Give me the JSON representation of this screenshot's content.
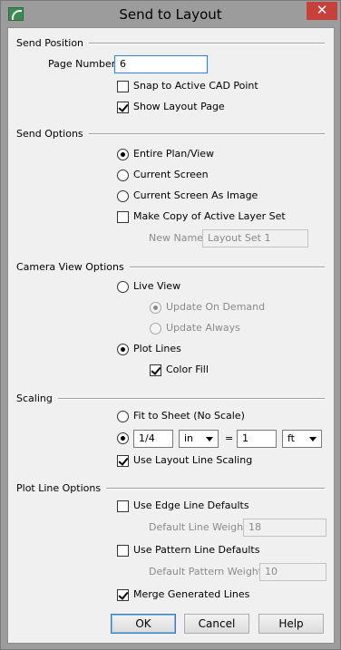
{
  "window": {
    "title": "Send to Layout",
    "close_glyph": "✕"
  },
  "send_position": {
    "heading": "Send Position",
    "page_number_label": "Page Number:",
    "page_number_value": "6",
    "snap_label": "Snap to Active CAD Point",
    "snap_checked": false,
    "show_layout_label": "Show Layout Page",
    "show_layout_checked": true
  },
  "send_options": {
    "heading": "Send Options",
    "entire_plan": "Entire Plan/View",
    "current_screen": "Current Screen",
    "current_screen_image": "Current Screen As Image",
    "selected": "Entire Plan/View",
    "make_copy_label": "Make Copy of Active Layer Set",
    "make_copy_checked": false,
    "new_name_label": "New Name:",
    "new_name_value": "Layout Set 1"
  },
  "camera_view": {
    "heading": "Camera View Options",
    "live_view": "Live View",
    "update_on_demand": "Update On Demand",
    "update_always": "Update Always",
    "plot_lines": "Plot Lines",
    "selected": "Plot Lines",
    "color_fill_label": "Color Fill",
    "color_fill_checked": true
  },
  "scaling": {
    "heading": "Scaling",
    "fit_to_sheet": "Fit to Sheet (No Scale)",
    "scale_left_value": "1/4",
    "scale_left_unit": "in",
    "equals": "=",
    "scale_right_value": "1",
    "scale_right_unit": "ft",
    "layout_line_label": "Use Layout Line Scaling",
    "layout_line_checked": true
  },
  "plot_line_options": {
    "heading": "Plot Line Options",
    "edge_defaults_label": "Use Edge Line Defaults",
    "edge_defaults_checked": false,
    "default_line_weight_label": "Default Line Weight:",
    "default_line_weight_value": "18",
    "pattern_defaults_label": "Use Pattern Line Defaults",
    "pattern_defaults_checked": false,
    "default_pattern_weight_label": "Default Pattern Weight:",
    "default_pattern_weight_value": "10",
    "merge_label": "Merge Generated Lines",
    "merge_checked": true
  },
  "buttons": {
    "ok": "OK",
    "cancel": "Cancel",
    "help": "Help"
  },
  "colors": {
    "title_bar": "#9c9c9c",
    "close_button": "#c7413a",
    "dialog_bg": "#f0f0f0",
    "focus_border": "#3a7bd5"
  }
}
